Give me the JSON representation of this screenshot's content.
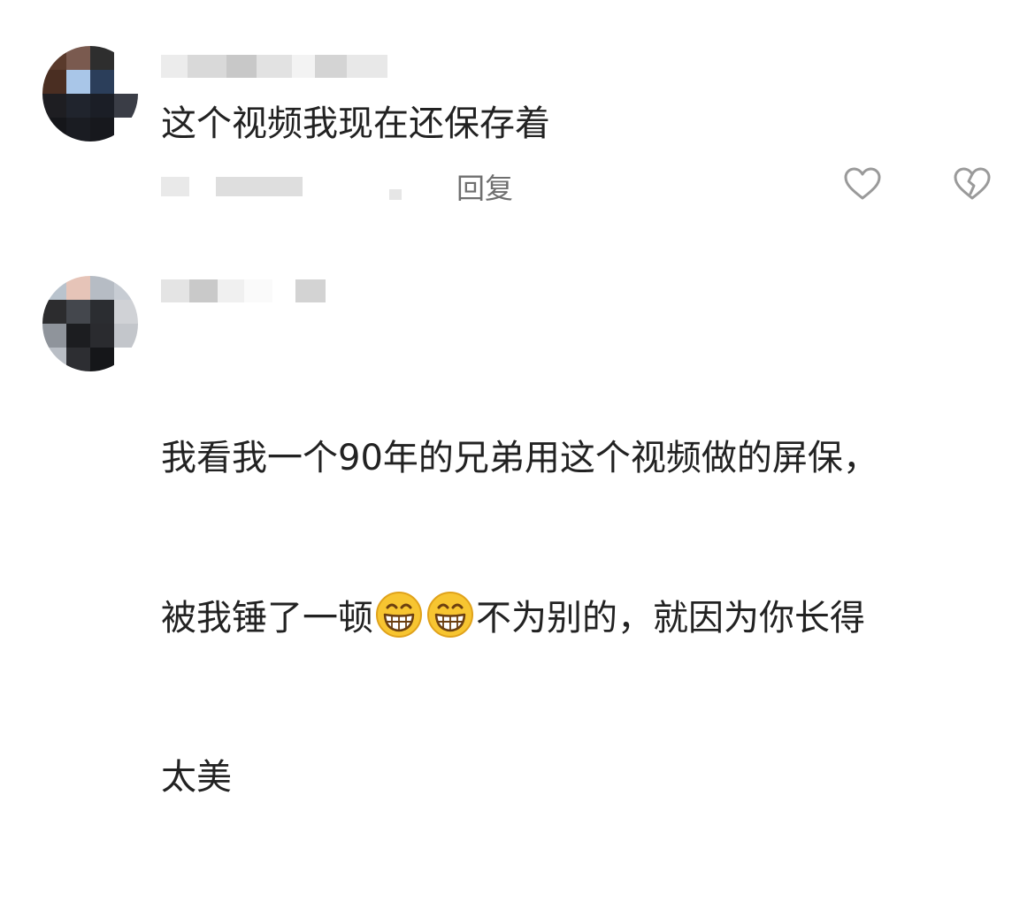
{
  "comments": [
    {
      "text": "这个视频我现在还保存着",
      "reply_label": "回复",
      "like_icon": "heart-outline-icon",
      "dislike_icon": "broken-heart-icon"
    },
    {
      "text_line1": "我看我一个90年的兄弟用这个视频做的屏保，",
      "text_line2_before": "被我锤了一顿",
      "text_line2_after": "不为别的，就因为你长得",
      "text_line3": "太美",
      "emoji_icon": "grinning-face-icon"
    }
  ],
  "colors": {
    "text": "#222222",
    "secondary": "#6f6f6f",
    "icon_stroke": "#9a9a9a",
    "emoji_face": "#f7c531"
  }
}
